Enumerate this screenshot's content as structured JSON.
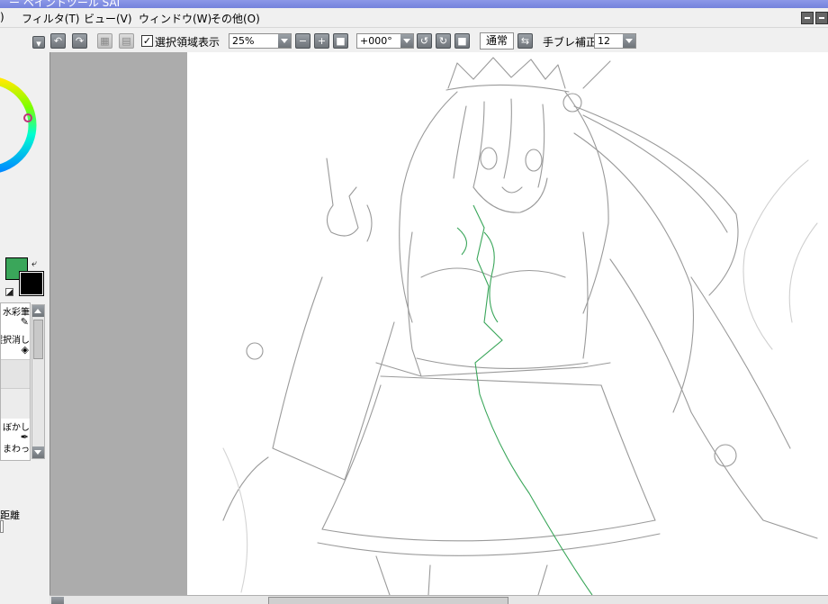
{
  "app": {
    "title": "ー ペイントツール SAI"
  },
  "menubar": {
    "items": [
      {
        "label": ")"
      },
      {
        "label": "フィルタ(T)"
      },
      {
        "label": "ビュー(V)"
      },
      {
        "label": "ウィンドウ(W)"
      },
      {
        "label": "その他(O)"
      }
    ]
  },
  "toolbar": {
    "selection_view_label": "選択領域表示",
    "selection_view_checked": true,
    "zoom_value": "25%",
    "rotation_value": "+000°",
    "blend_mode": "通常",
    "stabilizer_label": "手ブレ補正",
    "stabilizer_value": "12"
  },
  "left_panel": {
    "main_color": "#3aa65a",
    "sub_color": "#000000",
    "tools": [
      {
        "label": "水彩筆",
        "icon": "brush-icon"
      },
      {
        "label": "選択消し",
        "icon": "eraser-icon"
      },
      {
        "label": "ぼかし",
        "icon": "blur-icon"
      },
      {
        "label": "まわっ",
        "icon": "pen-icon"
      }
    ],
    "bottom_label": "距離"
  },
  "colors": {
    "canvas": "#ffffff",
    "outside_canvas": "#acacac",
    "lineart": "#9a9a9a",
    "selection_line": "#3aa65a"
  }
}
